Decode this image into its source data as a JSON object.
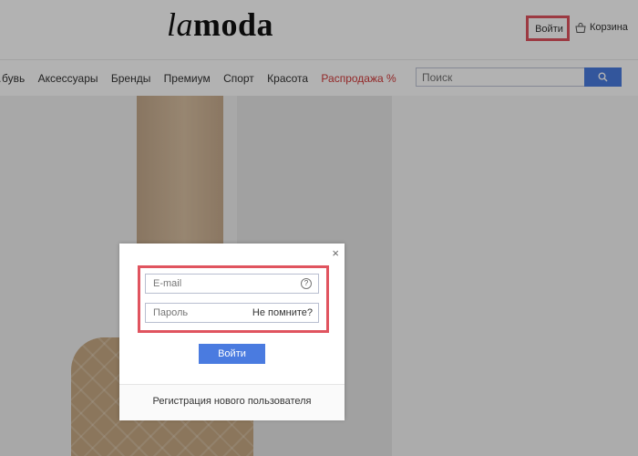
{
  "header": {
    "logo_la": "la",
    "logo_moda": "moda",
    "login_label": "Войти",
    "cart_label": "Корзина"
  },
  "nav": {
    "items": [
      "…бувь",
      "Аксессуары",
      "Бренды",
      "Премиум",
      "Спорт",
      "Красота"
    ],
    "sale_label": "Распродажа %",
    "search_placeholder": "Поиск"
  },
  "modal": {
    "email_placeholder": "E-mail",
    "help_symbol": "?",
    "password_placeholder": "Пароль",
    "forgot_label": "Не помните?",
    "submit_label": "Войти",
    "register_label": "Регистрация нового пользователя",
    "close_symbol": "×"
  },
  "colors": {
    "accent": "#4a7be0",
    "highlight": "#e0545f",
    "sale": "#d23a3a"
  },
  "icons": {
    "cart": "bag-icon",
    "search": "search-icon",
    "help": "question-circle-icon",
    "close": "close-icon"
  }
}
